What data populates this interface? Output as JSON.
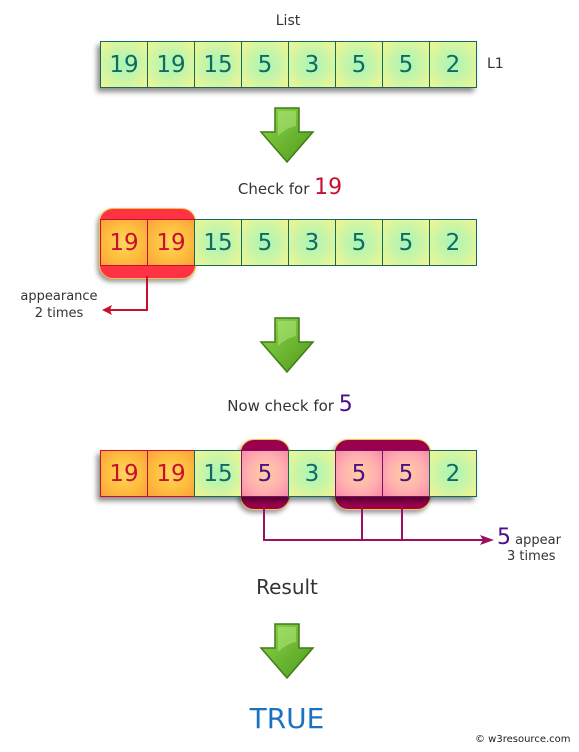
{
  "title": "List",
  "list_name": "L1",
  "list_values": [
    "19",
    "19",
    "15",
    "5",
    "3",
    "5",
    "5",
    "2"
  ],
  "step1": {
    "label": "Check for ",
    "value": "19",
    "value_color": "#c8102e",
    "annotation_line1": "appearance",
    "annotation_line2": "2 times"
  },
  "step2": {
    "label": "Now check for ",
    "value": "5",
    "value_color": "#4b1087",
    "annotation_value": "5",
    "annotation_line1": " appear",
    "annotation_line2": "3 times"
  },
  "result": {
    "label": "Result",
    "value": "TRUE",
    "value_color": "#1a73c0"
  },
  "copyright": "© w3resource.com",
  "icons": {
    "down_arrow": "green-down-arrow-icon"
  }
}
